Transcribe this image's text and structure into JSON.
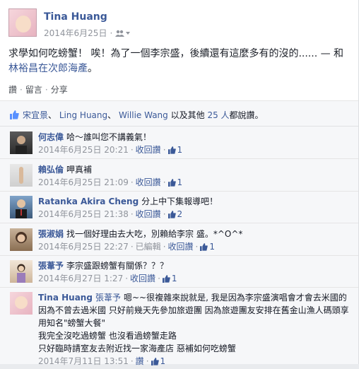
{
  "post": {
    "author": "Tina Huang",
    "date": "2014年6月25日",
    "text": "求學如何吃螃蟹！ 唉！為了一個李宗盛，後續還有這麼多有的沒的...... — 和",
    "tagged_text": "林裕昌在次郎海產",
    "text_end": "。",
    "actions": [
      "讚",
      "留言",
      "分享"
    ]
  },
  "likes": {
    "names": [
      "宋宜景",
      "Ling Huang",
      "Willie Wang"
    ],
    "sep": "、",
    "suffix_pre": "以及其他",
    "others": "25 人",
    "suffix_post": "都說讚。"
  },
  "comments": [
    {
      "name": "何志偉",
      "text": "哈～誰叫您不講義氣！",
      "time": "2014年6月25日 20:21",
      "action": "收回讚",
      "likes": "1"
    },
    {
      "name": "賴弘倫",
      "text": "呷真補",
      "time": "2014年6月25日 21:09",
      "action": "收回讚",
      "likes": "1"
    },
    {
      "name": "Ratanka Akira Cheng",
      "text": "分上中下集報導吧！",
      "time": "2014年6月25日 21:38",
      "action": "收回讚",
      "likes": "2"
    },
    {
      "name": "張淑娟",
      "text": "找一個好理由去大吃，別賴給李宗 盛。*^O^*",
      "time": "2014年6月25日 22:27",
      "edited": "已編輯",
      "action": "收回讚",
      "likes": "1"
    },
    {
      "name": "張葦予",
      "text": "李宗盛跟螃蟹有關係？？？",
      "time": "2014年6月27日 1:27",
      "action": "收回讚",
      "likes": "1"
    },
    {
      "name": "Tina Huang",
      "mention": "張葦予",
      "text": "嗯~~很複雜來說就是, 我是因為李宗盛演唱會才會去米國的 因為不曾去過米國 只好前幾天先參加旅遊團 因為旅遊團友安排在舊金山漁人碼頭享用知名\"螃蟹大餐\"\n我完全沒吃過螃蟹 也沒看過螃蟹走路\n只好臨時請室友去附近找一家海產店 惡補如何吃螃蟹",
      "time": "2014年7月11日 13:51",
      "action": "讚",
      "likes": "1"
    }
  ],
  "colors": {
    "link": "#3b5998",
    "meta": "#90949c",
    "comment_bg": "#f6f7f9"
  }
}
